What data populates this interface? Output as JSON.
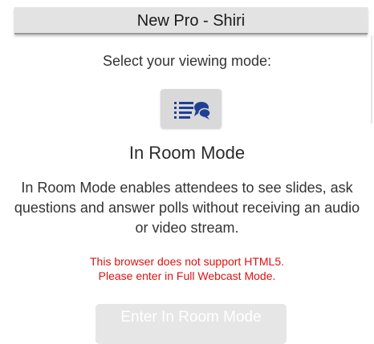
{
  "header": {
    "title": "New Pro - Shiri"
  },
  "main": {
    "prompt": "Select your viewing mode:",
    "mode_icon": "list-chat-icon",
    "mode_title": "In Room Mode",
    "description": "In Room Mode enables attendees to see slides, ask questions and answer polls without receiving an audio or video stream.",
    "warning_line1": "This browser does not support HTML5.",
    "warning_line2": "Please enter in Full Webcast Mode.",
    "enter_button_label": "Enter In Room Mode"
  },
  "colors": {
    "header_bg": "#e3e3e3",
    "icon_color": "#1f3f93",
    "warning": "#e01010",
    "disabled_button_bg": "#e6e6e6"
  }
}
